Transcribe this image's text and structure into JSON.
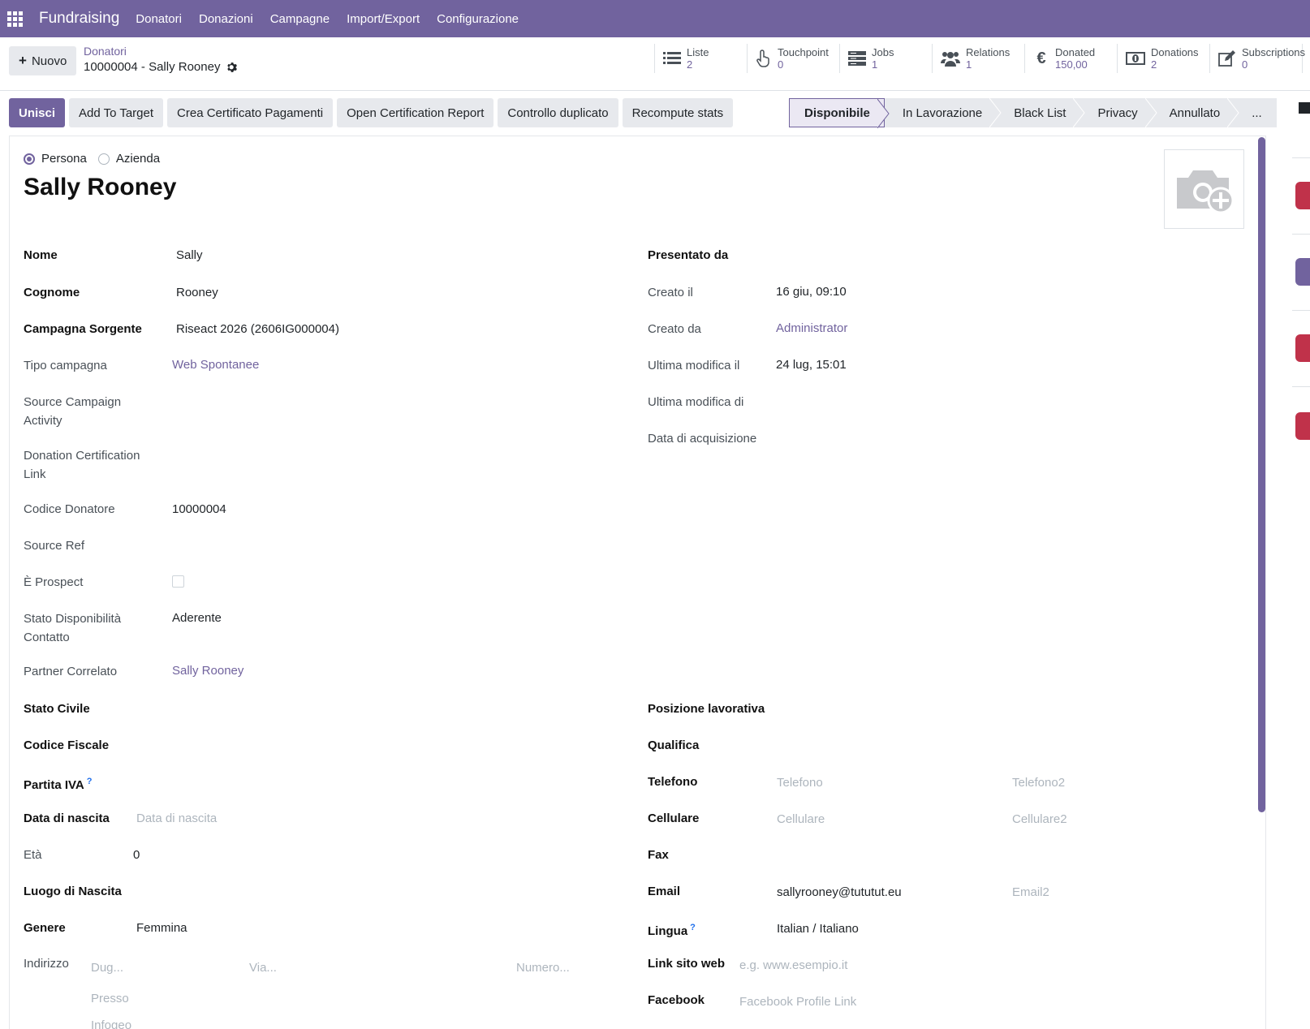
{
  "topbar": {
    "brand": "Fundraising",
    "menu": [
      "Donatori",
      "Donazioni",
      "Campagne",
      "Import/Export",
      "Configurazione"
    ]
  },
  "control": {
    "new_label": "Nuovo",
    "breadcrumb_parent": "Donatori",
    "breadcrumb_record": "10000004 - Sally Rooney",
    "stats": [
      {
        "label": "Liste",
        "value": "2",
        "icon": "list-icon"
      },
      {
        "label": "Touchpoint",
        "value": "0",
        "icon": "hand-pointer-icon"
      },
      {
        "label": "Jobs",
        "value": "1",
        "icon": "server-icon"
      },
      {
        "label": "Relations",
        "value": "1",
        "icon": "users-icon"
      },
      {
        "label": "Donated",
        "value": "150,00",
        "icon": "euro-icon"
      },
      {
        "label": "Donations",
        "value": "2",
        "icon": "money-icon"
      },
      {
        "label": "Subscriptions",
        "value": "0",
        "icon": "edit-icon"
      }
    ]
  },
  "actions": [
    "Unisci",
    "Add To Target",
    "Crea Certificato Pagamenti",
    "Open Certification Report",
    "Controllo duplicato",
    "Recompute stats"
  ],
  "status_stages": [
    "Disponibile",
    "In Lavorazione",
    "Black List",
    "Privacy",
    "Annullato",
    "..."
  ],
  "record": {
    "type_options": [
      "Persona",
      "Azienda"
    ],
    "selected_type": "Persona",
    "title": "Sally Rooney"
  },
  "left": {
    "nome": {
      "label": "Nome",
      "value": "Sally"
    },
    "cognome": {
      "label": "Cognome",
      "value": "Rooney"
    },
    "campagna_sorgente": {
      "label": "Campagna Sorgente",
      "value": "Riseact 2026 (2606IG000004)"
    },
    "tipo_campagna": {
      "label": "Tipo campagna",
      "value": "Web Spontanee"
    },
    "source_campaign_activity_1": "Source Campaign",
    "source_campaign_activity_2": "Activity",
    "donation_cert_link_1": "Donation Certification",
    "donation_cert_link_2": "Link",
    "codice_donatore": {
      "label": "Codice Donatore",
      "value": "10000004"
    },
    "source_ref": "Source Ref",
    "prospect": "È Prospect",
    "stato_disp_1": "Stato Disponibilità",
    "stato_disp_2": "Contatto",
    "stato_disp_value": "Aderente",
    "partner": {
      "label": "Partner Correlato",
      "value": "Sally Rooney"
    },
    "stato_civile": "Stato Civile",
    "codice_fiscale": "Codice Fiscale",
    "partita_iva": "Partita IVA",
    "help_mark": "?",
    "data_nascita": {
      "label": "Data di nascita",
      "placeholder": "Data di nascita"
    },
    "eta": {
      "label": "Età",
      "value": "0"
    },
    "luogo_nascita": "Luogo di Nascita",
    "genere": {
      "label": "Genere",
      "value": "Femmina"
    },
    "indirizzo": {
      "label": "Indirizzo",
      "dug": "Dug...",
      "via": "Via...",
      "numero": "Numero...",
      "presso": "Presso",
      "infogeo": "Infogeo"
    }
  },
  "right": {
    "presentato_da": "Presentato da",
    "creato_il": {
      "label": "Creato il",
      "value": "16 giu, 09:10"
    },
    "creato_da": {
      "label": "Creato da",
      "value": "Administrator"
    },
    "ultima_modifica_il": {
      "label": "Ultima modifica il",
      "value": "24 lug, 15:01"
    },
    "ultima_modifica_di": "Ultima modifica di",
    "data_acquisizione": "Data di acquisizione",
    "posizione": "Posizione lavorativa",
    "qualifica": "Qualifica",
    "telefono": {
      "label": "Telefono",
      "ph1": "Telefono",
      "ph2": "Telefono2"
    },
    "cellulare": {
      "label": "Cellulare",
      "ph1": "Cellulare",
      "ph2": "Cellulare2"
    },
    "fax": "Fax",
    "email": {
      "label": "Email",
      "value": "sallyrooney@tututut.eu",
      "ph2": "Email2"
    },
    "lingua": {
      "label": "Lingua",
      "value": "Italian / Italiano"
    },
    "sito": {
      "label": "Link sito web",
      "placeholder": "e.g. www.esempio.it"
    },
    "facebook": {
      "label": "Facebook",
      "placeholder": "Facebook Profile Link"
    }
  },
  "colors": {
    "brand": "#71639e",
    "badge": "#c0324a"
  }
}
